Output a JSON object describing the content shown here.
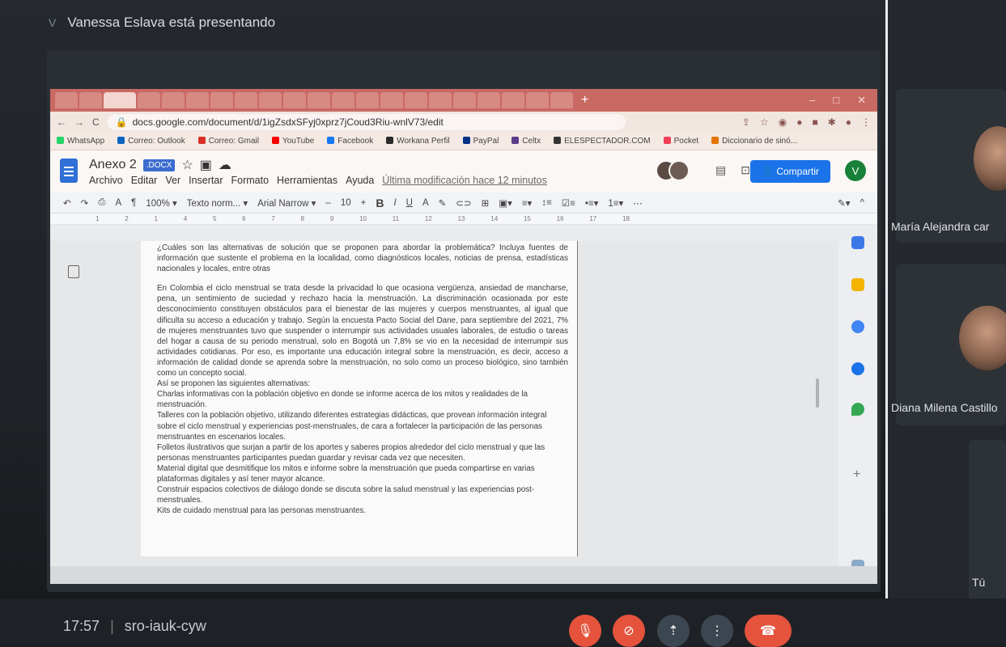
{
  "meet": {
    "presenter_initial": "V",
    "presenter_text": "Vanessa Eslava está presentando",
    "time": "17:57",
    "separator": "|",
    "meeting_code": "sro-iauk-cyw",
    "participants": [
      {
        "name": "María Alejandra car"
      },
      {
        "name": "Diana Milena Castillo"
      },
      {
        "name": "Tú"
      }
    ],
    "controls": {
      "mic": "mic-off-icon",
      "camera": "camera-off-icon",
      "present": "present-icon",
      "more": "more-icon",
      "hangup": "hangup-icon"
    },
    "colors": {
      "hangup": "#e5533d",
      "muted": "#e5533d"
    }
  },
  "browser": {
    "url": "docs.google.com/document/d/1igZsdxSFyj0xprz7jCoud3Riu-wnlV73/edit",
    "bookmarks": [
      "WhatsApp",
      "Correo: Outlook",
      "Correo: Gmail",
      "YouTube",
      "Facebook",
      "Workana Perfil",
      "PayPal",
      "Celtx",
      "ELESPECTADOR.COM",
      "Pocket",
      "Diccionario de sinó..."
    ]
  },
  "docs": {
    "title": "Anexo 2",
    "badge": ".DOCX",
    "menus": [
      "Archivo",
      "Editar",
      "Ver",
      "Insertar",
      "Formato",
      "Herramientas",
      "Ayuda"
    ],
    "last_modified": "Última modificación hace 12 minutos",
    "share_label": "Compartir",
    "user_initial": "V",
    "toolbar": {
      "zoom": "100%",
      "style": "Texto norm...",
      "font": "Arial Narrow",
      "size": "10"
    },
    "ruler": [
      "1",
      "2",
      "1",
      "4",
      "5",
      "6",
      "7",
      "8",
      "9",
      "10",
      "11",
      "12",
      "13",
      "14",
      "15",
      "16",
      "17",
      "18"
    ],
    "body": {
      "question": "¿Cuáles son las alternativas de solución que se proponen para abordar la problemática? Incluya fuentes de información que sustente el problema en la localidad, como diagnósticos locales, noticias de prensa, estadísticas nacionales y locales, entre otras",
      "paragraph": "En Colombia el ciclo menstrual se trata desde la privacidad lo que ocasiona vergüenza, ansiedad de mancharse, pena, un sentimiento de suciedad y rechazo hacia la menstruación. La discriminación ocasionada por este desconocimiento constituyen obstáculos para el bienestar de las mujeres y cuerpos menstruantes, al igual que dificulta su acceso a educación y trabajo. Según la encuesta Pacto Social del Dane, para septiembre del 2021, 7% de mujeres menstruantes tuvo que suspender o interrumpir sus actividades usuales laborales, de estudio o tareas del hogar a causa de su periodo menstrual, solo en Bogotá un 7,8% se vio en la necesidad de interrumpir sus actividades cotidianas. Por eso, es importante una educación integral sobre la menstruación, es decir, acceso a información de calidad donde se aprenda sobre la menstruación, no solo como un proceso biológico, sino también como un concepto social.",
      "intro": "Así se proponen las siguientes alternativas:",
      "items": [
        "Charlas informativas con la población objetivo en donde se informe acerca de los mitos y realidades de la menstruación.",
        "Talleres con la población objetivo, utilizando diferentes estrategias didácticas, que provean información integral sobre el ciclo menstrual y experiencias post-menstruales, de cara a fortalecer la participación de las personas menstruantes en escenarios locales.",
        "Folletos ilustrativos que surjan a partir de los aportes y saberes propios alrededor del ciclo menstrual y que las personas menstruantes participantes puedan guardar y revisar cada vez que necesiten.",
        "Material digital que desmitifique los mitos e informe sobre la menstruación que pueda compartirse en varias plataformas digitales y así tener mayor alcance.",
        "Construir espacios colectivos de diálogo donde se discuta sobre la salud menstrual y las experiencias post-menstruales.",
        "Kits de cuidado menstrual para las personas menstruantes."
      ]
    }
  }
}
